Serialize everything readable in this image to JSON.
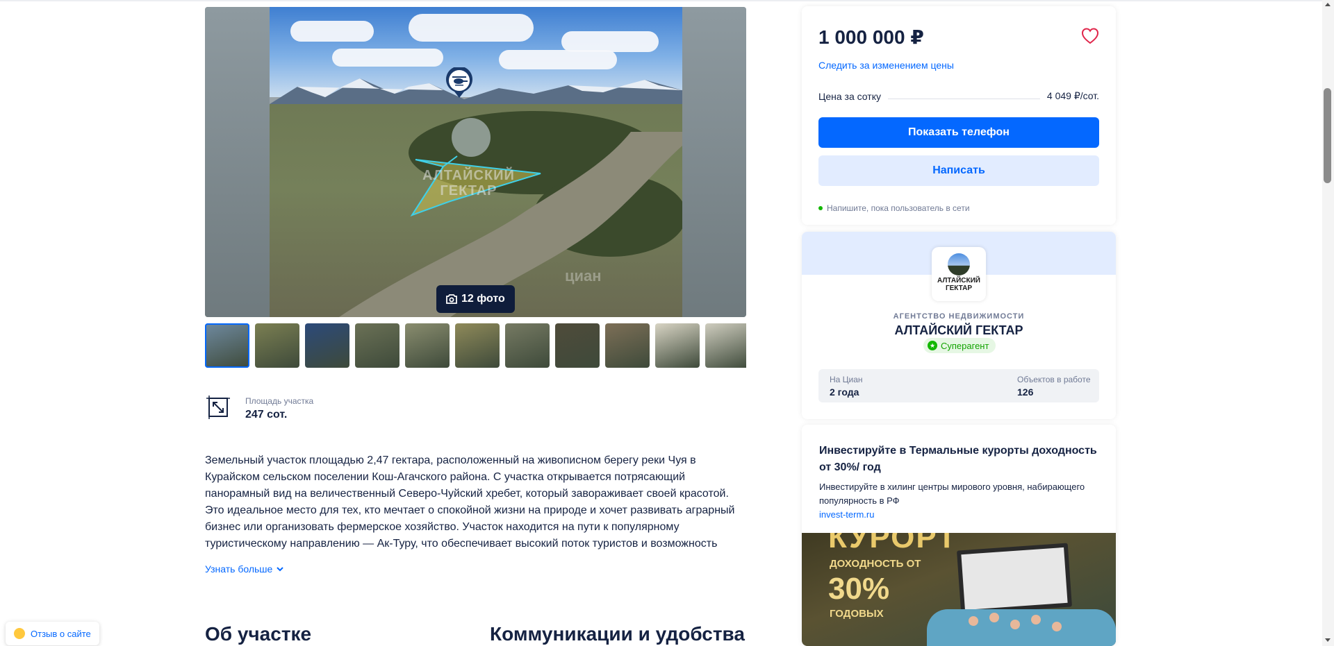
{
  "gallery": {
    "photo_count_label": "12 фото",
    "watermark_line1": "АЛТАЙСКИЙ",
    "watermark_line2": "ГЕКТАР",
    "cian_watermark": "циан",
    "thumbnails": [
      {
        "color": "#6f8aa0"
      },
      {
        "color": "#7b7f52"
      },
      {
        "color": "#2c4a7a"
      },
      {
        "color": "#6b7156"
      },
      {
        "color": "#8a8d6f"
      },
      {
        "color": "#8f8a5a"
      },
      {
        "color": "#767a63"
      },
      {
        "color": "#4f4b3a"
      },
      {
        "color": "#7d6f57"
      },
      {
        "color": "#d8d4c4"
      },
      {
        "color": "#cfcdbf"
      }
    ]
  },
  "feature": {
    "label": "Площадь участка",
    "value": "247 сот."
  },
  "description": {
    "text": "Земельный участок площадью 2,47 гектара, расположенный на живописном берегу реки Чуя в Курайском сельском поселении Кош-Агачского района. С участка открывается потрясающий панорамный вид на величественный Северо-Чуйский хребет, который завораживает своей красотой. Это идеальное место для тех, кто мечтает о спокойной жизни на природе и хочет развивать аграрный бизнес или организовать фермерское хозяйство. Участок находится на пути к популярному туристическому направлению — Ак-Туру, что обеспечивает высокий поток туристов и возможность",
    "more_label": "Узнать больше"
  },
  "sections": {
    "about": "Об участке",
    "utilities": "Коммуникации и удобства"
  },
  "feedback": {
    "label": "Отзыв о сайте"
  },
  "price_card": {
    "price": "1 000 000 ₽",
    "follow_label": "Следить за изменением цены",
    "per_sotka_label": "Цена за сотку",
    "per_sotka_value": "4 049 ₽/сот.",
    "phone_button": "Показать телефон",
    "write_button": "Написать",
    "online_text": "Напишите, пока пользователь в сети"
  },
  "agent_card": {
    "logo_text_line1": "АЛТАЙСКИЙ",
    "logo_text_line2": "ГЕКТАР",
    "type": "АГЕНТСТВО НЕДВИЖИМОСТИ",
    "name": "АЛТАЙСКИЙ ГЕКТАР",
    "badge": "Суперагент",
    "stats": [
      {
        "label": "На Циан",
        "value": "2 года"
      },
      {
        "label": "Объектов в работе",
        "value": "126"
      }
    ]
  },
  "ad_card": {
    "title": "Инвестируйте в Термальные курорты доходность от 30%/ год",
    "text": "Инвестируйте в хилинг центры мирового уровня, набирающего популярность в РФ",
    "link": "invest-term.ru",
    "image_word": "КУРОРТ",
    "image_sub": "ДОХОДНОСТЬ ОТ",
    "image_big": "30%",
    "image_sub2": "ГОДОВЫХ"
  },
  "colors": {
    "accent": "#0468ff",
    "accent_light": "#e2ecff",
    "text": "#152242",
    "muted": "#707a95",
    "online": "#12b700"
  }
}
